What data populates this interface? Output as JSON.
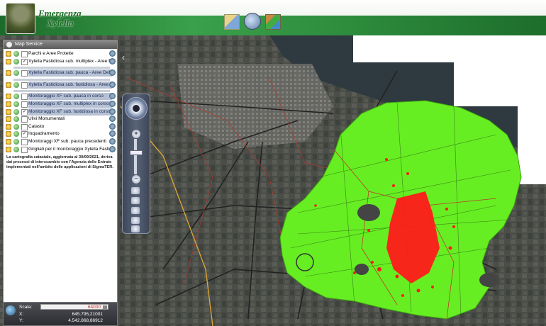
{
  "header": {
    "title_line1": "Emergenza",
    "title_line2": "Xylella",
    "icons": [
      "map-tools-icon",
      "gear-globe-icon",
      "map-layers-icon"
    ]
  },
  "panel": {
    "title": "Map Service",
    "layers": [
      {
        "label": "Parchi e Aree Protette",
        "checked": false,
        "highlight": false
      },
      {
        "label": "Xylella Fastidiosa sub. multiplex - Aree Delimitate",
        "checked": true,
        "highlight": false
      },
      {
        "label": "Xylella Fastidiosa sub. pauca - Aree Delimitate",
        "checked": false,
        "highlight": true
      },
      {
        "label": "Xylella Fastidiosa sub. fastidiosa - Aree Delimitate",
        "checked": false,
        "highlight": true
      },
      {
        "label": "Monitoraggio XF sub. pauca in corso",
        "checked": false,
        "highlight": true
      },
      {
        "label": "Monitoraggio XF sub. multiplex in corso",
        "checked": false,
        "highlight": true
      },
      {
        "label": "Monitoraggio XF sub. fastidiosa in corso",
        "checked": true,
        "highlight": true
      },
      {
        "label": "Ulivi Monumentali",
        "checked": false,
        "highlight": false
      },
      {
        "label": "Catasto",
        "checked": false,
        "highlight": false
      },
      {
        "label": "Inquadramento",
        "checked": true,
        "highlight": false
      },
      {
        "label": "Monitoraggi XF sub. pauca precedenti",
        "checked": false,
        "highlight": false
      },
      {
        "label": "Grigliati per il monitoraggio Xylella Fastidiosa",
        "checked": false,
        "highlight": false
      }
    ],
    "note": "La cartografia catastale, aggiornata al 30/09/2021, deriva dai processi di interscambio con l'Agenzia delle Entrate implementati nell'ambito delle applicazioni di SigmaTER."
  },
  "scale": {
    "label": "Scala:",
    "value": "64000",
    "x_label": "X:",
    "x_value": "645.795,21001",
    "y_label": "Y:",
    "y_value": "4.542.868,86912"
  },
  "colors": {
    "monitoring_area": "#66ee22",
    "positive_points": "#ff1a1a",
    "header_green": "#2e8b3c"
  }
}
